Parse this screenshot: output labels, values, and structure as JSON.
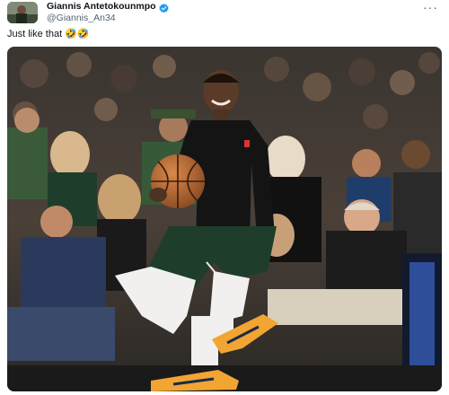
{
  "tweet": {
    "author_name": "Giannis Antetokounmpo",
    "author_handle": "@Giannis_An34",
    "verified": true,
    "more_label": "···",
    "text": "Just like that 🤣🤣"
  },
  "colors": {
    "verified_blue": "#1d9bf0",
    "handle_gray": "#536471",
    "jersey_green": "#1f3d2b",
    "shoe_orange": "#f2a532"
  },
  "icons": {
    "verified": "verified-badge-icon",
    "more": "more-options-icon"
  }
}
